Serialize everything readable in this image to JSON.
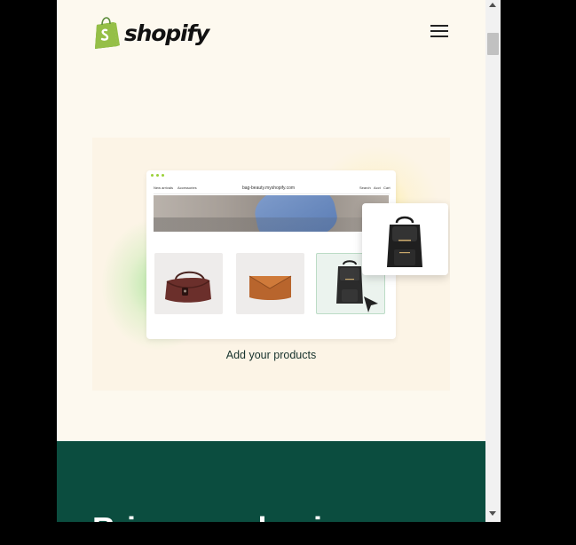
{
  "header": {
    "logo_text": "shopify",
    "menu_icon": "hamburger-menu-icon"
  },
  "hero": {
    "store_url": "bag-beauty.myshopify.com",
    "nav_left_1": "New arrivals",
    "nav_left_2": "Accessories",
    "nav_right_1": "Search",
    "nav_right_2": "Acct",
    "nav_right_3": "Cart",
    "caption": "Add your products",
    "colors": {
      "green_glow": "#7ddc6e",
      "yellow_glow": "#ffe97a",
      "selected_card_border": "#bcdcc6"
    }
  },
  "section": {
    "title": "Bring your business",
    "background": "#0b4d3f"
  }
}
